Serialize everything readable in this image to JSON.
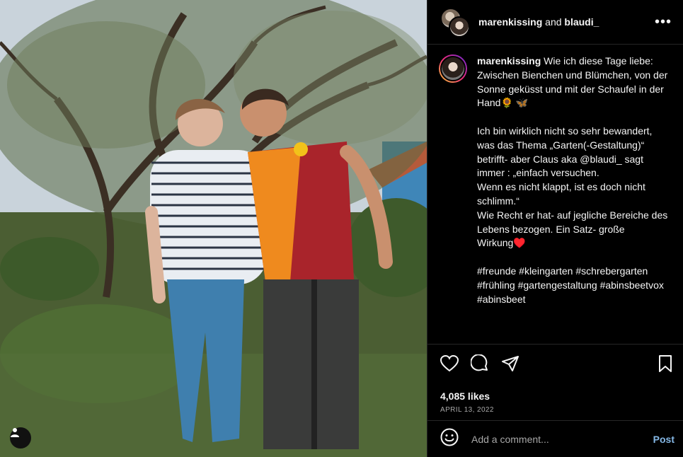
{
  "header": {
    "user1": "marenkissing",
    "joiner": "and",
    "user2": "blaudi_",
    "more_label": "•••"
  },
  "caption": {
    "username": "marenkissing",
    "text": " Wie ich diese Tage liebe: Zwischen Bienchen und Blümchen, von der Sonne geküsst und mit der Schaufel in der Hand🌻 🦋\n\nIch bin wirklich nicht so sehr bewandert, was das Thema „Garten(-Gestaltung)“ betrifft- aber Claus aka @blaudi_ sagt immer : „einfach versuchen.\nWenn es nicht klappt, ist es doch nicht schlimm.“\nWie Recht er hat- auf jegliche Bereiche des Lebens bezogen. Ein Satz- große Wirkung♥️\n\n#freunde #kleingarten #schrebergarten #frühling #gartengestaltung #abinsbeetvox #abinsbeet"
  },
  "stats": {
    "likes": "4,085 likes",
    "date": "APRIL 13, 2022"
  },
  "comment": {
    "placeholder": "Add a comment...",
    "post_label": "Post"
  },
  "icons": [
    "user-tag-icon",
    "heart-icon",
    "comment-icon",
    "share-icon",
    "bookmark-icon",
    "emoji-icon",
    "more-icon"
  ]
}
